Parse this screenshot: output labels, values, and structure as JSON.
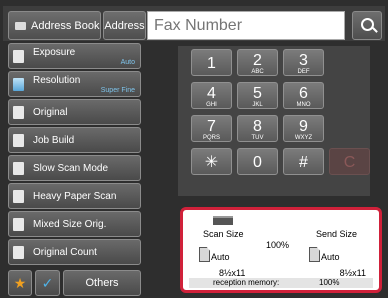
{
  "topbar": {
    "address_book_label": "Address Book",
    "address_label": "Address",
    "fax_placeholder": "Fax Number"
  },
  "menu": [
    {
      "label": "Exposure",
      "sub": "Auto"
    },
    {
      "label": "Resolution",
      "sub": "Super Fine"
    },
    {
      "label": "Original",
      "sub": ""
    },
    {
      "label": "Job Build",
      "sub": ""
    },
    {
      "label": "Slow Scan Mode",
      "sub": ""
    },
    {
      "label": "Heavy Paper Scan",
      "sub": ""
    },
    {
      "label": "Mixed Size Orig.",
      "sub": ""
    },
    {
      "label": "Original Count",
      "sub": ""
    }
  ],
  "bottom": {
    "star_icon": "★",
    "check_icon": "✓",
    "others_label": "Others"
  },
  "keypad": {
    "keys": [
      {
        "num": "1",
        "letters": ""
      },
      {
        "num": "2",
        "letters": "ABC"
      },
      {
        "num": "3",
        "letters": "DEF"
      },
      {
        "num": "4",
        "letters": "GHI"
      },
      {
        "num": "5",
        "letters": "JKL"
      },
      {
        "num": "6",
        "letters": "MNO"
      },
      {
        "num": "7",
        "letters": "PQRS"
      },
      {
        "num": "8",
        "letters": "TUV"
      },
      {
        "num": "9",
        "letters": "WXYZ"
      },
      {
        "num": "✳",
        "letters": ""
      },
      {
        "num": "0",
        "letters": ""
      },
      {
        "num": "#",
        "letters": ""
      },
      {
        "num": "C",
        "letters": ""
      }
    ]
  },
  "status": {
    "scan_size_label": "Scan Size",
    "send_size_label": "Send Size",
    "ratio": "100%",
    "scan_mode": "Auto",
    "send_mode": "Auto",
    "scan_paper": "8½x11",
    "send_paper": "8½x11",
    "memory_label": "reception memory:",
    "memory_value": "100%"
  }
}
